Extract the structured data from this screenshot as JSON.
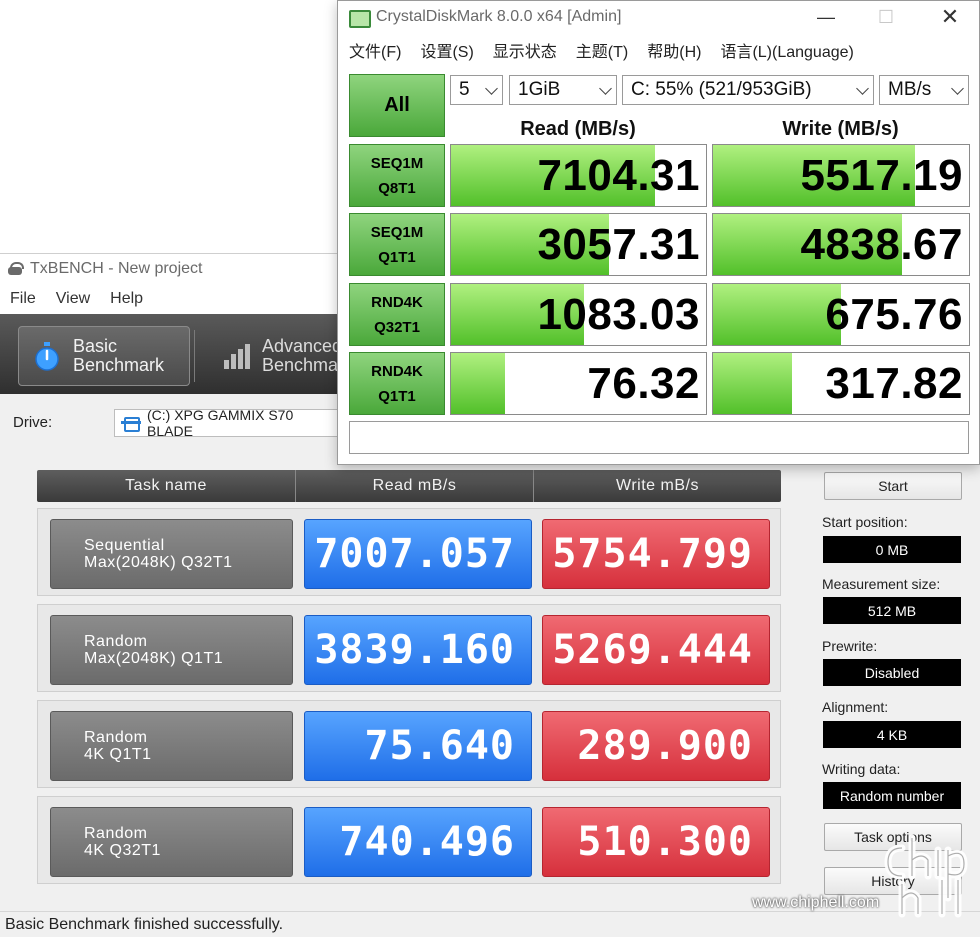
{
  "txbench": {
    "title": "TxBENCH - New project",
    "menu": [
      "File",
      "View",
      "Help"
    ],
    "tabs": {
      "basic": [
        "Basic",
        "Benchmark"
      ],
      "advanced": [
        "Advanced",
        "Benchmar"
      ]
    },
    "drive_label": "Drive:",
    "drive_value": "(C:) XPG GAMMIX S70 BLADE",
    "table_headers": [
      "Task name",
      "Read mB/s",
      "Write mB/s"
    ],
    "rows": [
      {
        "name1": "Sequential",
        "name2": "Max(2048K) Q32T1",
        "read": "7007.057",
        "write": "5754.799"
      },
      {
        "name1": "Random",
        "name2": "Max(2048K) Q1T1",
        "read": "3839.160",
        "write": "5269.444"
      },
      {
        "name1": "Random",
        "name2": "4K Q1T1",
        "read": "75.640",
        "write": "289.900"
      },
      {
        "name1": "Random",
        "name2": "4K Q32T1",
        "read": "740.496",
        "write": "510.300"
      }
    ],
    "side": {
      "start_btn": "Start",
      "start_position_label": "Start position:",
      "start_position": "0 MB",
      "measurement_size_label": "Measurement size:",
      "measurement_size": "512 MB",
      "prewrite_label": "Prewrite:",
      "prewrite": "Disabled",
      "alignment_label": "Alignment:",
      "alignment": "4 KB",
      "writing_data_label": "Writing data:",
      "writing_data": "Random number",
      "task_options_btn": "Task options",
      "history_btn": "History"
    },
    "status": "Basic Benchmark finished successfully."
  },
  "cdm": {
    "title": "CrystalDiskMark 8.0.0 x64 [Admin]",
    "menu": [
      "文件(F)",
      "设置(S)",
      "显示状态",
      "主题(T)",
      "帮助(H)",
      "语言(L)(Language)"
    ],
    "all_btn": "All",
    "count": "5",
    "size": "1GiB",
    "drive": "C: 55% (521/953GiB)",
    "unit": "MB/s",
    "read_header": "Read (MB/s)",
    "write_header": "Write (MB/s)",
    "tests": [
      {
        "l1": "SEQ1M",
        "l2": "Q8T1",
        "read": "7104.31",
        "write": "5517.19",
        "read_fill": 0.8,
        "write_fill": 0.79
      },
      {
        "l1": "SEQ1M",
        "l2": "Q1T1",
        "read": "3057.31",
        "write": "4838.67",
        "read_fill": 0.62,
        "write_fill": 0.74
      },
      {
        "l1": "RND4K",
        "l2": "Q32T1",
        "read": "1083.03",
        "write": "675.76",
        "read_fill": 0.52,
        "write_fill": 0.5
      },
      {
        "l1": "RND4K",
        "l2": "Q1T1",
        "read": "76.32",
        "write": "317.82",
        "read_fill": 0.21,
        "write_fill": 0.31
      }
    ]
  },
  "watermark": {
    "text": "www.chiphell.com"
  },
  "colors": {
    "cdm_green": "#52c02a",
    "tx_read_blue": "#1f6ee8",
    "tx_write_red": "#d6303c"
  }
}
